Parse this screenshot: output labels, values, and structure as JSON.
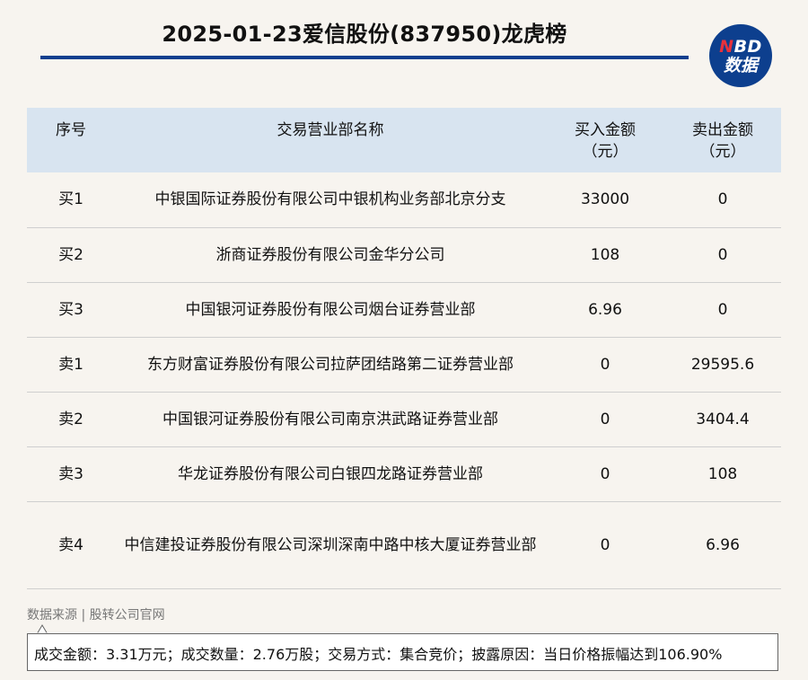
{
  "header": {
    "title": "2025-01-23爱信股份(837950)龙虎榜",
    "logo_top": "NBD",
    "logo_bottom": "数据"
  },
  "colors": {
    "accent": "#0d3f8e",
    "header_row": "#d8e4f0",
    "background": "#f7f4ef",
    "logo_n": "#e8323c"
  },
  "table": {
    "columns": [
      "序号",
      "交易营业部名称",
      "买入金额",
      "卖出金额"
    ],
    "column_units": [
      "",
      "",
      "（元）",
      "（元）"
    ],
    "rows": [
      {
        "seq": "买1",
        "name": "中银国际证券股份有限公司中银机构业务部北京分支",
        "buy": "33000",
        "sell": "0"
      },
      {
        "seq": "买2",
        "name": "浙商证券股份有限公司金华分公司",
        "buy": "108",
        "sell": "0"
      },
      {
        "seq": "买3",
        "name": "中国银河证券股份有限公司烟台证券营业部",
        "buy": "6.96",
        "sell": "0"
      },
      {
        "seq": "卖1",
        "name": "东方财富证券股份有限公司拉萨团结路第二证券营业部",
        "buy": "0",
        "sell": "29595.6"
      },
      {
        "seq": "卖2",
        "name": "中国银河证券股份有限公司南京洪武路证券营业部",
        "buy": "0",
        "sell": "3404.4"
      },
      {
        "seq": "卖3",
        "name": "华龙证券股份有限公司白银四龙路证券营业部",
        "buy": "0",
        "sell": "108"
      },
      {
        "seq": "卖4",
        "name": "中信建投证券股份有限公司深圳深南中路中核大厦证券营业部",
        "buy": "0",
        "sell": "6.96"
      }
    ]
  },
  "footer": {
    "source": "数据来源 | 股转公司官网",
    "note": "成交金额：3.31万元；成交数量：2.76万股；交易方式：集合竞价；披露原因：当日价格振幅达到106.90%"
  }
}
